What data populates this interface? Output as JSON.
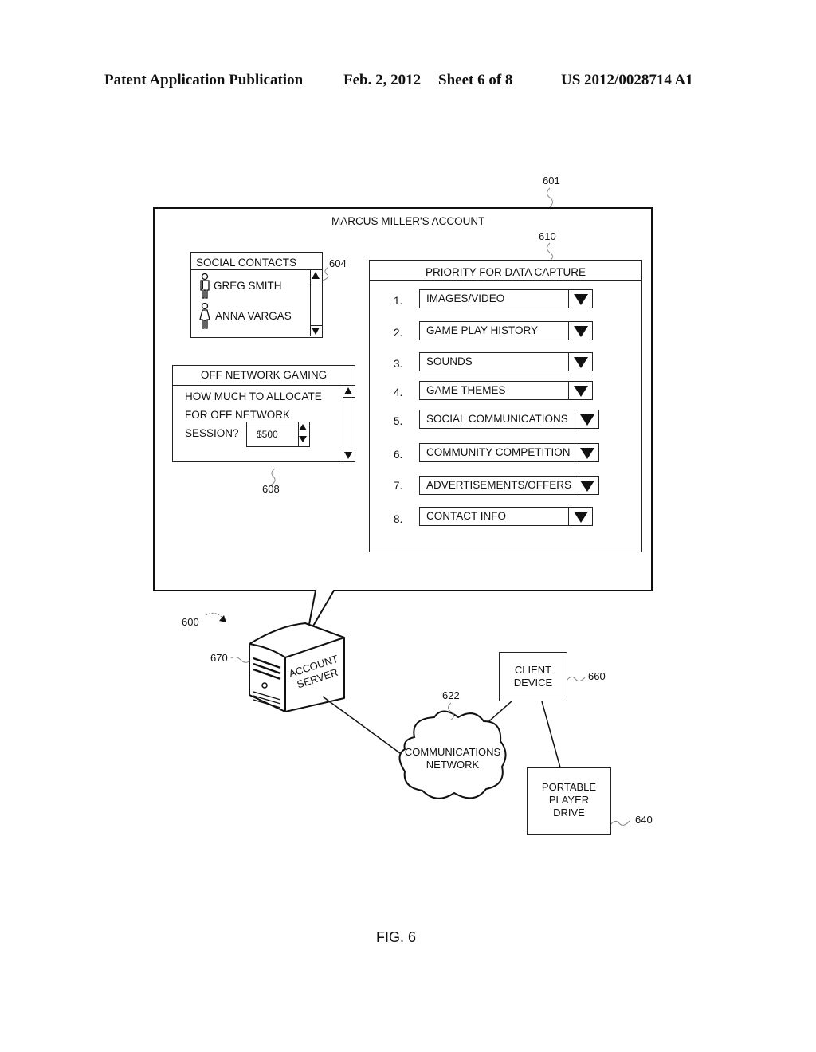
{
  "header": {
    "publication": "Patent Application Publication",
    "date": "Feb. 2, 2012",
    "sheet": "Sheet 6 of 8",
    "number": "US 2012/0028714 A1"
  },
  "refs": {
    "account_window": "601",
    "system": "600",
    "social_contacts": "604",
    "off_network": "608",
    "priority": "610",
    "network": "622",
    "portable_drive": "640",
    "client_device": "660",
    "account_server": "670"
  },
  "account_window": {
    "title": "MARCUS MILLER'S ACCOUNT"
  },
  "social_contacts": {
    "title": "SOCIAL CONTACTS",
    "contacts": [
      {
        "name": "GREG SMITH",
        "icon": "male-person-icon"
      },
      {
        "name": "ANNA VARGAS",
        "icon": "female-person-icon"
      }
    ]
  },
  "off_network": {
    "title": "OFF NETWORK GAMING",
    "question_lines": [
      "HOW MUCH TO ALLOCATE",
      "FOR OFF NETWORK",
      "SESSION?"
    ],
    "amount": "$500"
  },
  "priority": {
    "title": "PRIORITY FOR DATA CAPTURE",
    "items": [
      {
        "num": "1.",
        "value": "IMAGES/VIDEO"
      },
      {
        "num": "2.",
        "value": "GAME PLAY HISTORY"
      },
      {
        "num": "3.",
        "value": "SOUNDS"
      },
      {
        "num": "4.",
        "value": "GAME THEMES"
      },
      {
        "num": "5.",
        "value": "SOCIAL COMMUNICATIONS"
      },
      {
        "num": "6.",
        "value": "COMMUNITY COMPETITION"
      },
      {
        "num": "7.",
        "value": "ADVERTISEMENTS/OFFERS"
      },
      {
        "num": "8.",
        "value": "CONTACT INFO"
      }
    ]
  },
  "nodes": {
    "server_line1": "ACCOUNT",
    "server_line2": "SERVER",
    "network_line1": "COMMUNICATIONS",
    "network_line2": "NETWORK",
    "client_line1": "CLIENT",
    "client_line2": "DEVICE",
    "drive_line1": "PORTABLE",
    "drive_line2": "PLAYER",
    "drive_line3": "DRIVE"
  },
  "caption": "FIG. 6"
}
